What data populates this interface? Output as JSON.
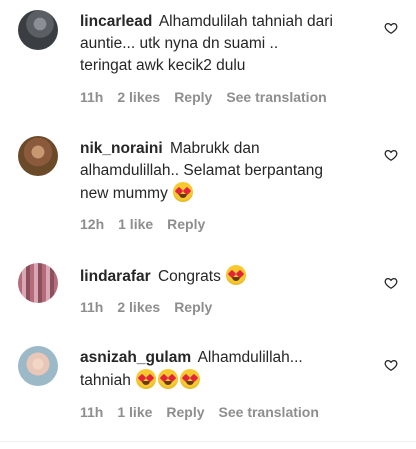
{
  "comments": [
    {
      "username": "lincarlead",
      "lines": [
        "Alhamdulilah tahniah dari",
        "auntie... utk nyna dn suami ..",
        "teringat awk kecik2 dulu"
      ],
      "time": "11h",
      "likes": "2 likes",
      "reply": "Reply",
      "see_translation": "See translation"
    },
    {
      "username": "nik_noraini",
      "lines": [
        "Mabrukk dan",
        "alhamdulillah.. Selamat berpantang",
        "new mummy"
      ],
      "time": "12h",
      "likes": "1 like",
      "reply": "Reply"
    },
    {
      "username": "lindarafar",
      "lines": [
        "Congrats"
      ],
      "time": "11h",
      "likes": "2 likes",
      "reply": "Reply"
    },
    {
      "username": "asnizah_gulam",
      "lines": [
        "Alhamdulillah...",
        "tahniah"
      ],
      "time": "11h",
      "likes": "1 like",
      "reply": "Reply",
      "see_translation": "See translation"
    }
  ],
  "icons": {
    "like": "heart-outline-icon",
    "emoji": "heart-eyes-emoji"
  }
}
